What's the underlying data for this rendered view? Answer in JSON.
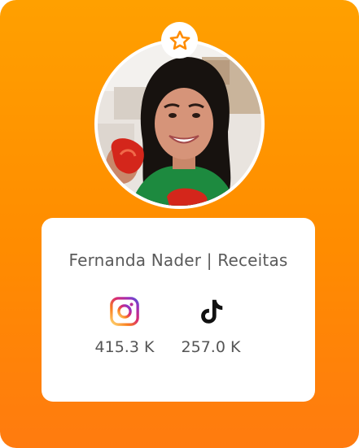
{
  "profile": {
    "name": "Fernanda Nader | Receitas",
    "avatar_icon": "profile-photo",
    "badge_icon": "star-icon"
  },
  "stats": [
    {
      "platform_icon": "instagram-icon",
      "value": "415.3 K"
    },
    {
      "platform_icon": "tiktok-icon",
      "value": "257.0 K"
    }
  ],
  "colors": {
    "background_top": "#ffa000",
    "background_bottom": "#ff7b0f",
    "star": "#ff8c00",
    "text": "#5a5a5a"
  }
}
